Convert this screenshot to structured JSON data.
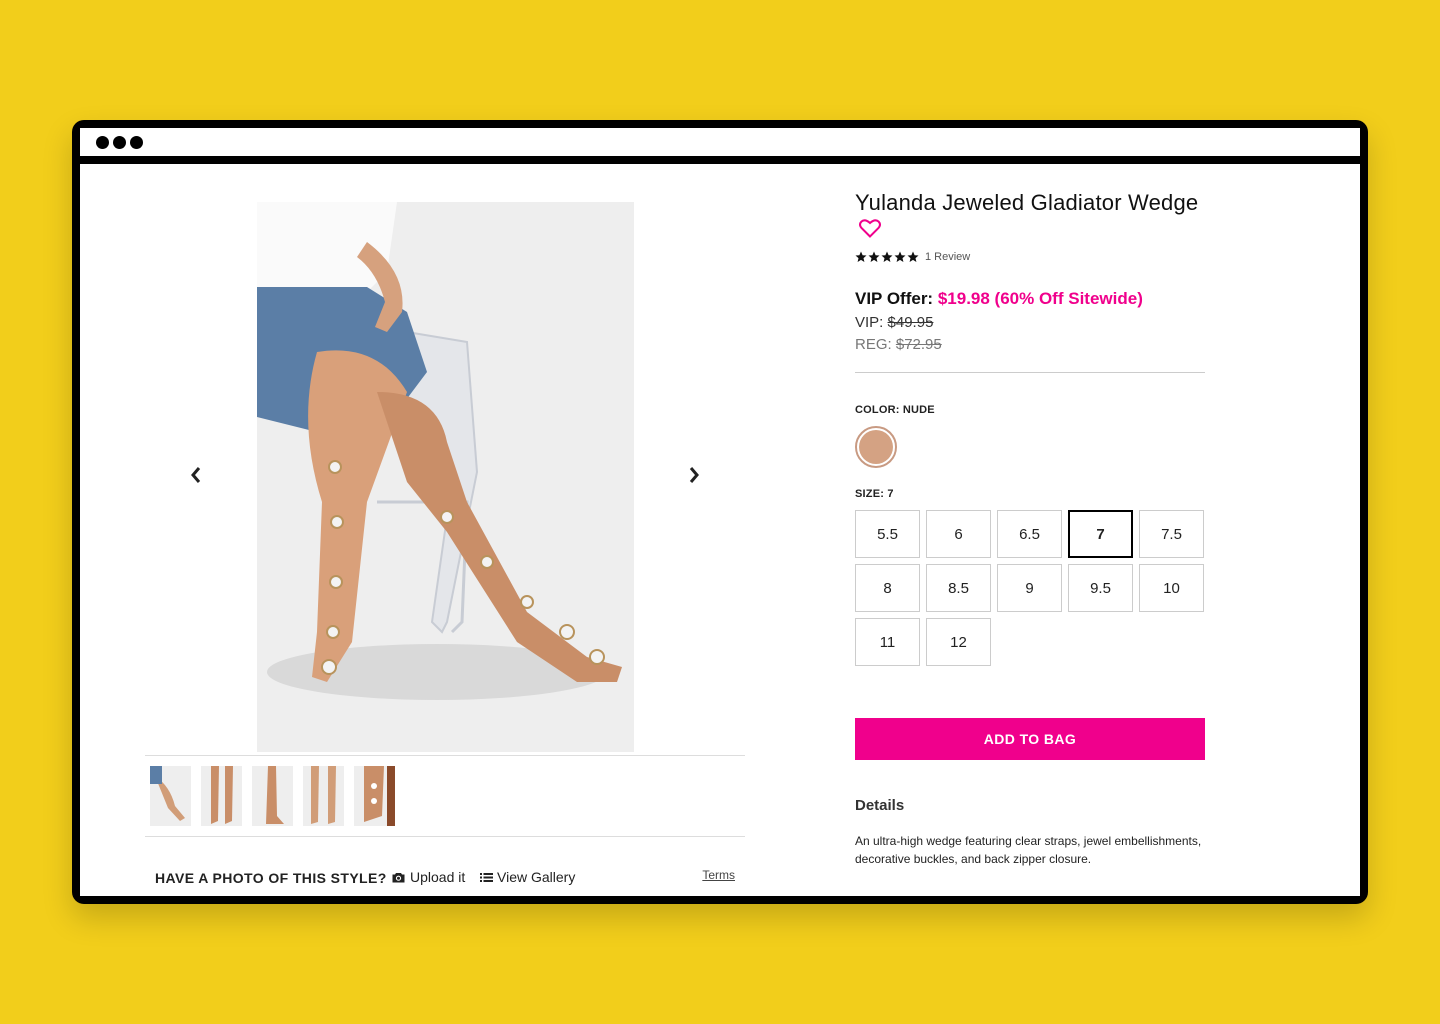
{
  "product": {
    "title": "Yulanda Jeweled Gladiator Wedge",
    "review_count_label": "1 Review",
    "rating": 5
  },
  "pricing": {
    "vip_offer_label": "VIP Offer:",
    "vip_offer_price": "$19.98 (60% Off Sitewide)",
    "vip_label": "VIP:",
    "vip_price": "$49.95",
    "reg_label": "REG:",
    "reg_price": "$72.95"
  },
  "color": {
    "label": "COLOR:",
    "value": "NUDE",
    "swatch": "#D4A283"
  },
  "size": {
    "label": "SIZE:",
    "value": "7",
    "options": [
      "5.5",
      "6",
      "6.5",
      "7",
      "7.5",
      "8",
      "8.5",
      "9",
      "9.5",
      "10",
      "11",
      "12"
    ],
    "selected_index": 3
  },
  "add_to_bag_label": "ADD TO BAG",
  "details": {
    "title": "Details",
    "text": "An ultra-high wedge featuring clear straps, jewel embellishments, decorative buckles, and back zipper closure."
  },
  "photo_prompt": {
    "title": "HAVE A PHOTO OF THIS STYLE?",
    "upload_label": "Upload it",
    "view_gallery_label": "View Gallery",
    "terms_label": "Terms"
  },
  "colors": {
    "accent": "#F0008C",
    "background": "#F2CE1B"
  },
  "icons": {
    "prev": "chevron-left-icon",
    "next": "chevron-right-icon",
    "favorite": "heart-outline-icon",
    "camera": "camera-icon",
    "list": "list-icon",
    "star": "star-icon"
  }
}
